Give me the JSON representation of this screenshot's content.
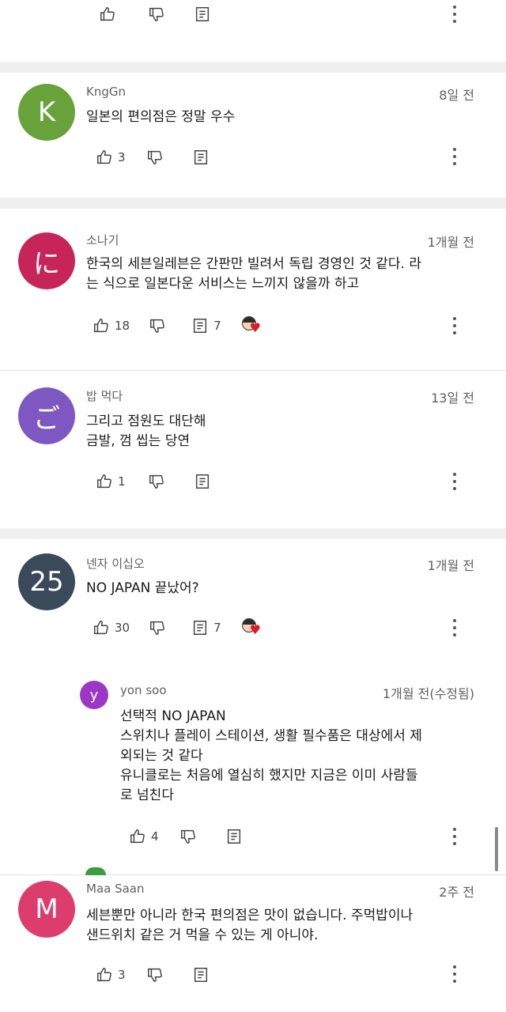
{
  "top_partial": {
    "actions": {
      "like_count": ""
    }
  },
  "comments": [
    {
      "avatar_letter": "K",
      "avatar_color": "#67a33a",
      "author": "KngGn",
      "time": "8일 전",
      "text": [
        "일본의 편의점은 정말 우수"
      ],
      "like_count": "3",
      "reply_count": ""
    },
    {
      "avatar_letter": "に",
      "avatar_color": "#c7255a",
      "author": "소나기",
      "time": "1개월 전",
      "text": [
        "한국의 세븐일레븐은 간판만 빌려서 독립 경영인 것 같다. 라",
        "는 식으로 일본다운 서비스는 느끼지 않을까 하고"
      ],
      "like_count": "18",
      "reply_count": "7"
    },
    {
      "avatar_letter": "ご",
      "avatar_color": "#7e57c2",
      "author": "밥 먹다",
      "time": "13일 전",
      "text": [
        "그리고 점원도 대단해",
        "금발, 껌 씹는 당연"
      ],
      "like_count": "1",
      "reply_count": ""
    },
    {
      "avatar_letter": "25",
      "avatar_color": "#3a4a5a",
      "author": "넨자 이십오",
      "time": "1개월 전",
      "text": [
        "NO JAPAN 끝났어?"
      ],
      "like_count": "30",
      "reply_count": "7"
    },
    {
      "avatar_letter": "M",
      "avatar_color": "#dd3d6d",
      "author": "Maa Saan",
      "time": "2주 전",
      "text": [
        "세븐뿐만 아니라 한국 편의점은 맛이 없습니다. 주먹밥이나",
        "샌드위치 같은 거 먹을 수 있는 게 아니야."
      ],
      "like_count": "3",
      "reply_count": ""
    }
  ],
  "reply": {
    "avatar_letter": "y",
    "avatar_color": "#9b38c6",
    "author": "yon soo",
    "time": "1개월 전(수정됨)",
    "text": [
      "선택적 NO JAPAN",
      "스위치나 플레이 스테이션, 생활 필수품은 대상에서 제",
      "외되는 것 같다",
      "유니클로는 처음에 열심히 했지만 지금은 이미 사람들",
      "로 넘친다"
    ],
    "like_count": "4"
  },
  "icons": {
    "like": "thumb-up-icon",
    "dislike": "thumb-down-icon",
    "reply": "reply-comment-icon",
    "more": "more-vert-icon",
    "creator_heart": "creator-heart-icon"
  }
}
